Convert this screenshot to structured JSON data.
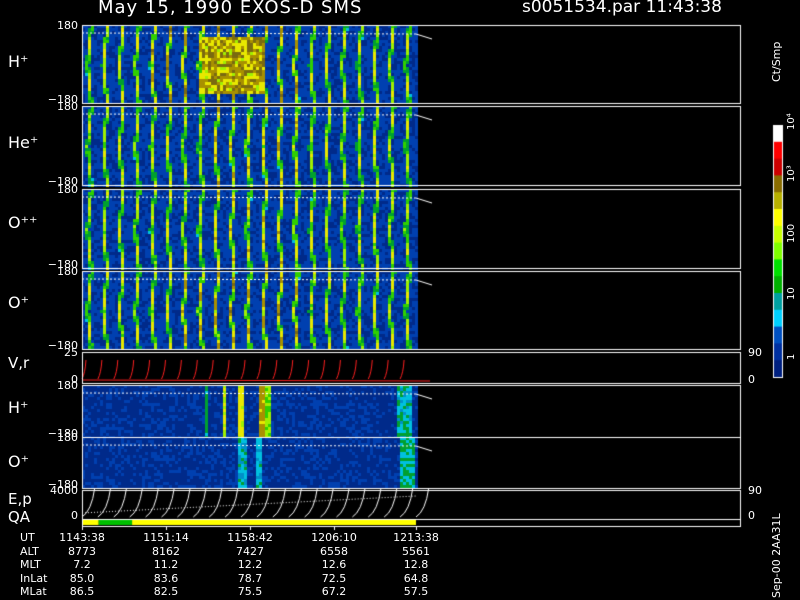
{
  "header": {
    "title": "May 15, 1990   EXOS-D SMS",
    "file_time": "s0051534.par  11:43:38"
  },
  "colorbar": {
    "label": "Ct/Smp",
    "ticks": [
      "10⁴",
      "10³",
      "100",
      "10",
      "1"
    ],
    "colors": [
      "#ffffff",
      "#ff0000",
      "#cc0000",
      "#8a6d00",
      "#b7b000",
      "#ffff00",
      "#c8ff00",
      "#7fff00",
      "#00e000",
      "#00b000",
      "#00a0a0",
      "#00d0ff",
      "#0050c0",
      "#0030a0",
      "#002080"
    ]
  },
  "side_label": "Sep-00  2AA31L",
  "panels": [
    {
      "id": "h-plus-angle",
      "label": "H⁺",
      "ymax": "180",
      "ymin": "−180"
    },
    {
      "id": "he-plus",
      "label": "He⁺",
      "ymax": "180",
      "ymin": "−180"
    },
    {
      "id": "o-plusplus",
      "label": "O⁺⁺",
      "ymax": "180",
      "ymin": "−180"
    },
    {
      "id": "o-plus-angle",
      "label": "O⁺",
      "ymax": "180",
      "ymin": "−180"
    },
    {
      "id": "vr",
      "label": "V,r",
      "ymax": "25",
      "ymin": "0",
      "rmax": "90",
      "rmin": "0"
    },
    {
      "id": "h-plus-2",
      "label": "H⁺",
      "ymax": "180",
      "ymin": "−180"
    },
    {
      "id": "o-plus-2",
      "label": "O⁺",
      "ymax": "180",
      "ymin": "−180"
    },
    {
      "id": "ep",
      "label": "E,p",
      "ymax": "4000",
      "ymin": "0",
      "rmax": "90",
      "rmin": "0"
    },
    {
      "id": "qa",
      "label": "QA"
    }
  ],
  "ephemeris": {
    "rows": [
      {
        "name": "UT",
        "values": [
          "1143:38",
          "1151:14",
          "1158:42",
          "1206:10",
          "1213:38"
        ]
      },
      {
        "name": "ALT",
        "values": [
          "8773",
          "8162",
          "7427",
          "6558",
          "5561"
        ]
      },
      {
        "name": "MLT",
        "values": [
          "7.2",
          "11.2",
          "12.2",
          "12.6",
          "12.8"
        ]
      },
      {
        "name": "InLat",
        "values": [
          "85.0",
          "83.6",
          "78.7",
          "72.5",
          "64.8"
        ]
      },
      {
        "name": "MLat",
        "values": [
          "86.5",
          "82.5",
          "75.5",
          "67.2",
          "57.5"
        ]
      }
    ]
  },
  "chart_data": {
    "type": "heatmap",
    "title": "May 15, 1990   EXOS-D SMS",
    "x_ticks": [
      "1143:38",
      "1151:14",
      "1158:42",
      "1206:10",
      "1213:38"
    ],
    "colorbar_scale": "log",
    "colorbar_range": [
      1,
      10000
    ],
    "spin_period_columns": 21,
    "qa_segments": [
      {
        "from": 0.0,
        "to": 0.05,
        "color": "#ffff00"
      },
      {
        "from": 0.05,
        "to": 0.15,
        "color": "#00c000"
      },
      {
        "from": 0.15,
        "to": 1.0,
        "color": "#ffff00"
      }
    ]
  }
}
